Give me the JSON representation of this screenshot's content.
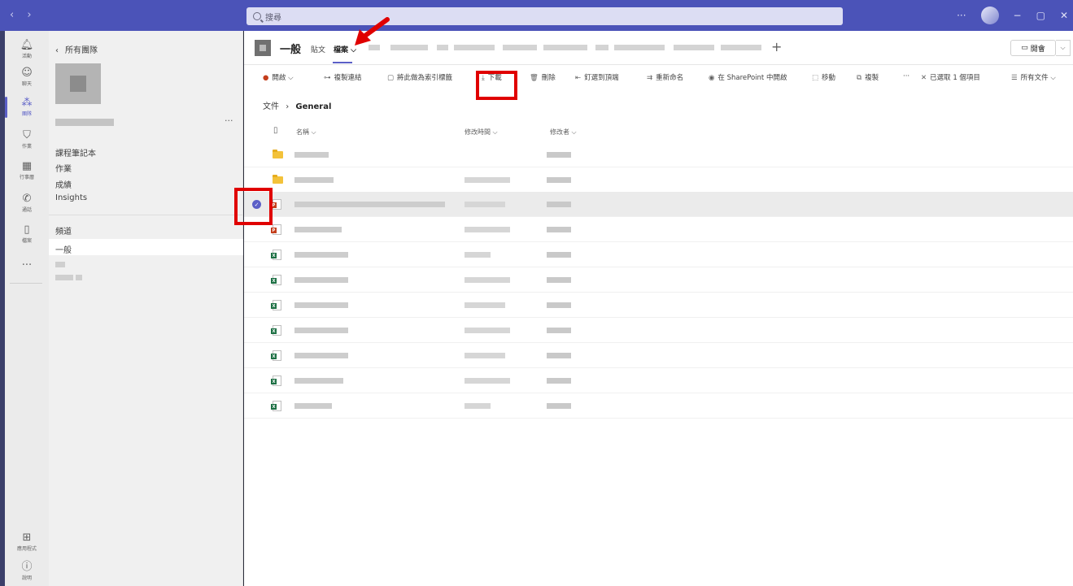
{
  "titlebar": {
    "search_placeholder": "搜尋",
    "more": "···",
    "minimize": "−",
    "maximize": "▢",
    "close": "✕"
  },
  "rail": [
    {
      "label": "活動",
      "icon": "bell-icon"
    },
    {
      "label": "聊天",
      "icon": "chat-icon"
    },
    {
      "label": "團隊",
      "icon": "teams-icon",
      "active": true
    },
    {
      "label": "作業",
      "icon": "assignments-icon"
    },
    {
      "label": "行事曆",
      "icon": "calendar-icon"
    },
    {
      "label": "通話",
      "icon": "phone-icon"
    },
    {
      "label": "檔案",
      "icon": "file-icon"
    }
  ],
  "rail_bottom": [
    {
      "label": "應用程式",
      "icon": "apps-icon"
    },
    {
      "label": "說明",
      "icon": "help-icon"
    }
  ],
  "sidebar": {
    "back_label": "所有團隊",
    "team_more": "···",
    "menu_items": [
      "課程筆記本",
      "作業",
      "成績",
      "Insights"
    ],
    "channels_header": "頻道",
    "active_channel": "一般"
  },
  "channel": {
    "name": "一般",
    "tabs": [
      "貼文",
      "檔案"
    ],
    "active_tab": "檔案",
    "add_tab": "+",
    "meet_label": "開會"
  },
  "toolbar": {
    "open": "開啟",
    "copy_link": "複製連結",
    "make_tab": "將此做為索引標籤",
    "download": "下載",
    "delete": "刪除",
    "pin": "釘選到頂端",
    "rename": "重新命名",
    "open_sharepoint": "在 SharePoint 中開啟",
    "move": "移動",
    "copy": "複製",
    "more": "···",
    "selected": "已選取 1 個項目",
    "all_docs": "所有文件"
  },
  "breadcrumb": {
    "root": "文件",
    "current": "General"
  },
  "columns": {
    "name": "名稱",
    "modified": "修改時間",
    "modified_by": "修改者"
  },
  "files": [
    {
      "type": "folder"
    },
    {
      "type": "folder"
    },
    {
      "type": "pdf",
      "selected": true
    },
    {
      "type": "pdf"
    },
    {
      "type": "excel"
    },
    {
      "type": "excel"
    },
    {
      "type": "excel"
    },
    {
      "type": "excel"
    },
    {
      "type": "excel"
    },
    {
      "type": "excel"
    },
    {
      "type": "excel"
    }
  ],
  "colors": {
    "accent": "#5b5fc7",
    "titlebar": "#4b53b8",
    "annotation": "#e00000"
  }
}
